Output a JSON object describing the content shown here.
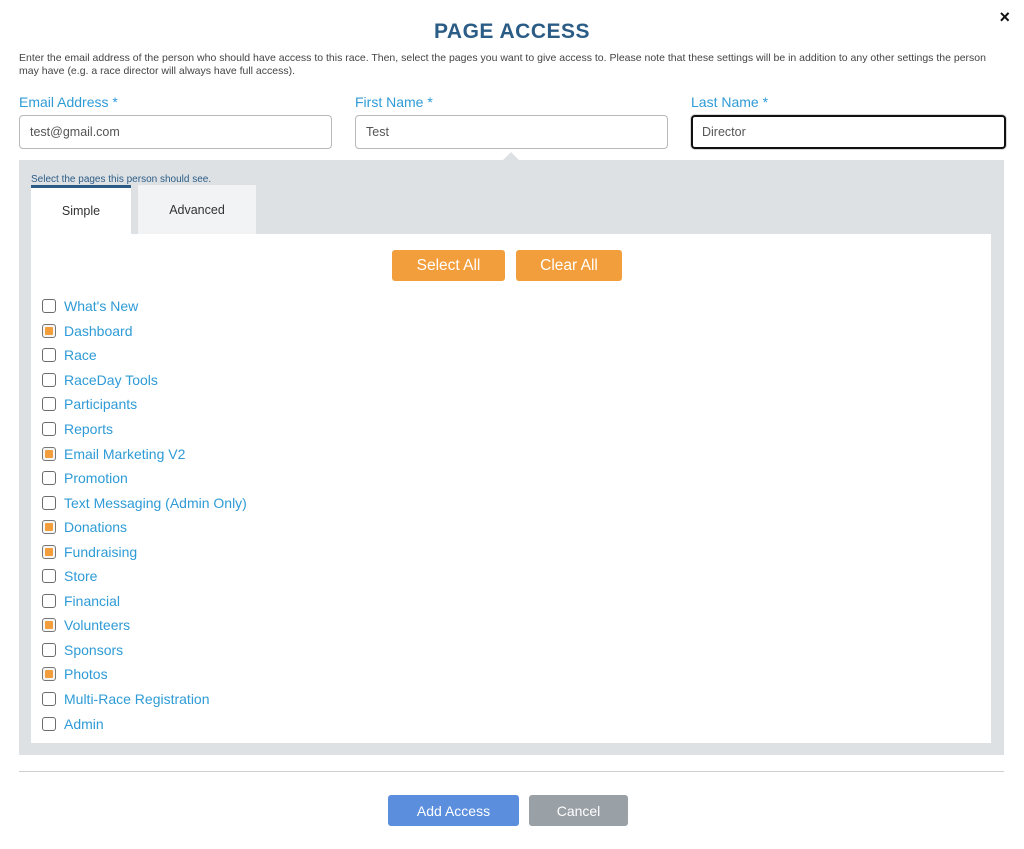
{
  "dialog": {
    "title": "PAGE ACCESS",
    "close_icon": "×",
    "intro": "Enter the email address of the person who should have access to this race. Then, select the pages you want to give access to. Please note that these settings will be in addition to any other settings the person may have (e.g. a race director will always have full access)."
  },
  "form": {
    "email": {
      "label": "Email Address *",
      "value": "test@gmail.com"
    },
    "first_name": {
      "label": "First Name *",
      "value": "Test"
    },
    "last_name": {
      "label": "Last Name *",
      "value": "Director"
    }
  },
  "pages_panel": {
    "hint": "Select the pages this person should see.",
    "tabs": [
      {
        "label": "Simple",
        "active": true
      },
      {
        "label": "Advanced",
        "active": false
      }
    ],
    "select_all_label": "Select All",
    "clear_all_label": "Clear All",
    "pages": [
      {
        "label": "What's New",
        "checked": false
      },
      {
        "label": "Dashboard",
        "checked": true
      },
      {
        "label": "Race",
        "checked": false
      },
      {
        "label": "RaceDay Tools",
        "checked": false
      },
      {
        "label": "Participants",
        "checked": false
      },
      {
        "label": "Reports",
        "checked": false
      },
      {
        "label": "Email Marketing V2",
        "checked": true
      },
      {
        "label": "Promotion",
        "checked": false
      },
      {
        "label": "Text Messaging (Admin Only)",
        "checked": false
      },
      {
        "label": "Donations",
        "checked": true
      },
      {
        "label": "Fundraising",
        "checked": true
      },
      {
        "label": "Store",
        "checked": false
      },
      {
        "label": "Financial",
        "checked": false
      },
      {
        "label": "Volunteers",
        "checked": true
      },
      {
        "label": "Sponsors",
        "checked": false
      },
      {
        "label": "Photos",
        "checked": true
      },
      {
        "label": "Multi-Race Registration",
        "checked": false
      },
      {
        "label": "Admin",
        "checked": false
      }
    ]
  },
  "footer": {
    "add_label": "Add Access",
    "cancel_label": "Cancel"
  },
  "colors": {
    "title": "#2b5c86",
    "link_blue": "#2e9bd6",
    "orange": "#f29e3d",
    "panel_gray": "#dee1e4",
    "primary_button": "#5b8fde",
    "secondary_button": "#99a0a6"
  }
}
